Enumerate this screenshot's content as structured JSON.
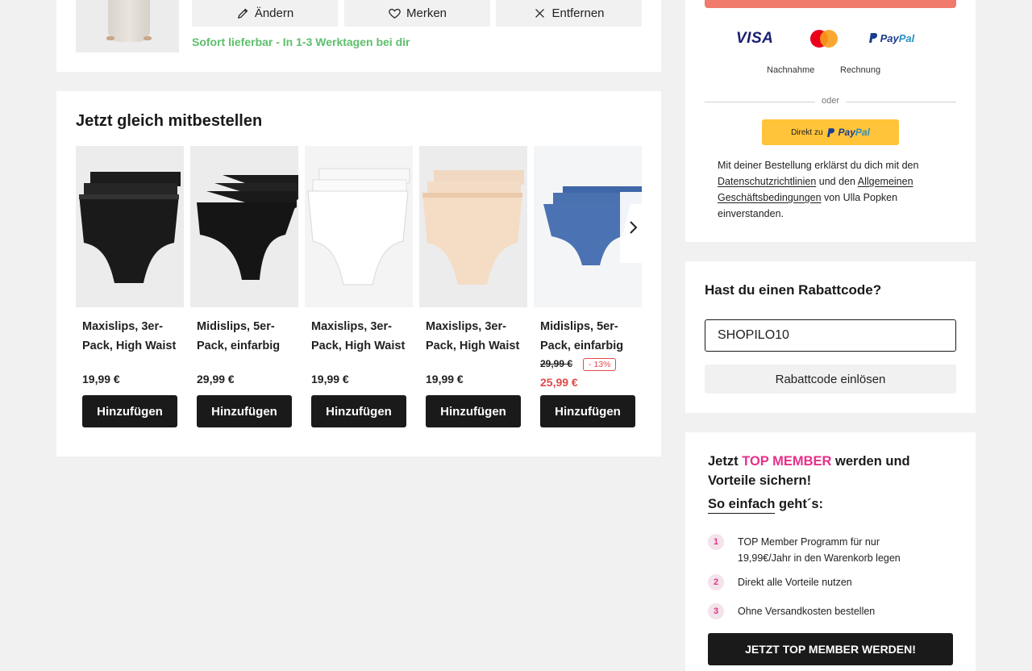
{
  "cart_item": {
    "actions": [
      {
        "label": "Ändern",
        "icon": "pencil-icon"
      },
      {
        "label": "Merken",
        "icon": "heart-icon"
      },
      {
        "label": "Entfernen",
        "icon": "close-icon"
      }
    ],
    "availability": "Sofort lieferbar - In 1-3 Werktagen bei dir",
    "availability_color": "#5cbf6b"
  },
  "recommendations": {
    "title": "Jetzt gleich mitbestellen",
    "add_label": "Hinzufügen",
    "products": [
      {
        "name": "Maxislips, 3er-Pack, High Waist",
        "price": "19,99 €",
        "color": "black"
      },
      {
        "name": "Midislips, 5er-Pack, einfarbig",
        "price": "29,99 €",
        "color": "black"
      },
      {
        "name": "Maxislips, 3er-Pack, High Waist",
        "price": "19,99 €",
        "color": "white"
      },
      {
        "name": "Maxislips, 3er-Pack, High Waist",
        "price": "19,99 €",
        "color": "beige"
      },
      {
        "name": "Midislips, 5er-Pack, einfarbig",
        "old_price": "29,99 €",
        "discount": "- 13%",
        "price": "25,99 €",
        "color": "blue"
      }
    ],
    "next_icon": "chevron-right-icon"
  },
  "payment": {
    "methods": {
      "visa": "VISA",
      "paypal_p": "Pay",
      "paypal_pal": "Pal",
      "mastercard": "mastercard-icon"
    },
    "cod": "Nachnahme",
    "invoice": "Rechnung",
    "or": "oder",
    "paypal_direct": {
      "prefix": "Direkt zu",
      "pay": "Pay",
      "pal": "Pal"
    },
    "legal": {
      "t1": "Mit deiner Bestellung erklärst du dich mit den ",
      "link1": "Datenschutzrichtlinien",
      "t2": " und den ",
      "link2": "Allgemeinen Geschäftsbedingungen",
      "t3": " von Ulla Popken einverstanden."
    },
    "accent": "#f07a6b"
  },
  "coupon": {
    "title": "Hast du einen Rabattcode?",
    "value": "SHOPILO10",
    "button": "Rabattcode einlösen"
  },
  "member": {
    "title_pre": "Jetzt ",
    "title_pink": "TOP MEMBER",
    "title_post": " werden und Vorteile sichern!",
    "sub_ul": "So einfach",
    "sub_rest": " geht´s:",
    "steps": [
      {
        "num": "1",
        "text": "TOP Member Programm für nur 19,99€/Jahr in den Warenkorb legen"
      },
      {
        "num": "2",
        "text": "Direkt alle Vorteile nutzen"
      },
      {
        "num": "3",
        "text": "Ohne Versandkosten bestellen"
      }
    ],
    "button": "JETZT TOP MEMBER WERDEN!",
    "accent": "#e6318a"
  }
}
